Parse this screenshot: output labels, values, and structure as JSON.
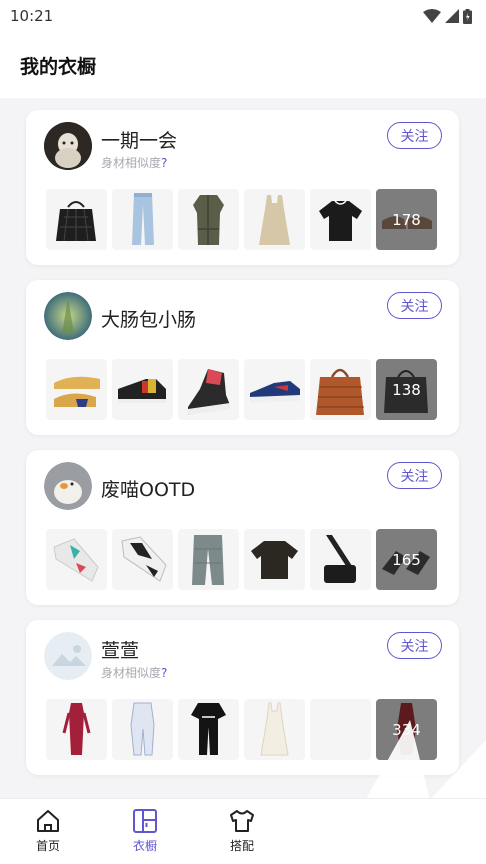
{
  "status": {
    "time": "10:21"
  },
  "header": {
    "title": "我的衣橱"
  },
  "cards": [
    {
      "name": "一期一会",
      "similarity": "身材相似度",
      "similarity_q": "?",
      "follow": "关注",
      "more_count": "178"
    },
    {
      "name": "大肠包小肠",
      "follow": "关注",
      "more_count": "138"
    },
    {
      "name": "废喵OOTD",
      "follow": "关注",
      "more_count": "165"
    },
    {
      "name": "萱萱",
      "similarity": "身材相似度",
      "similarity_q": "?",
      "follow": "关注",
      "more_count": "334"
    }
  ],
  "tabs": [
    {
      "label": "首页",
      "icon": "home-icon"
    },
    {
      "label": "衣橱",
      "icon": "wardrobe-icon"
    },
    {
      "label": "搭配",
      "icon": "tshirt-icon"
    }
  ],
  "colors": {
    "accent": "#5f57d0",
    "background": "#f4f4f6",
    "more_overlay": "#7d7d7d"
  }
}
